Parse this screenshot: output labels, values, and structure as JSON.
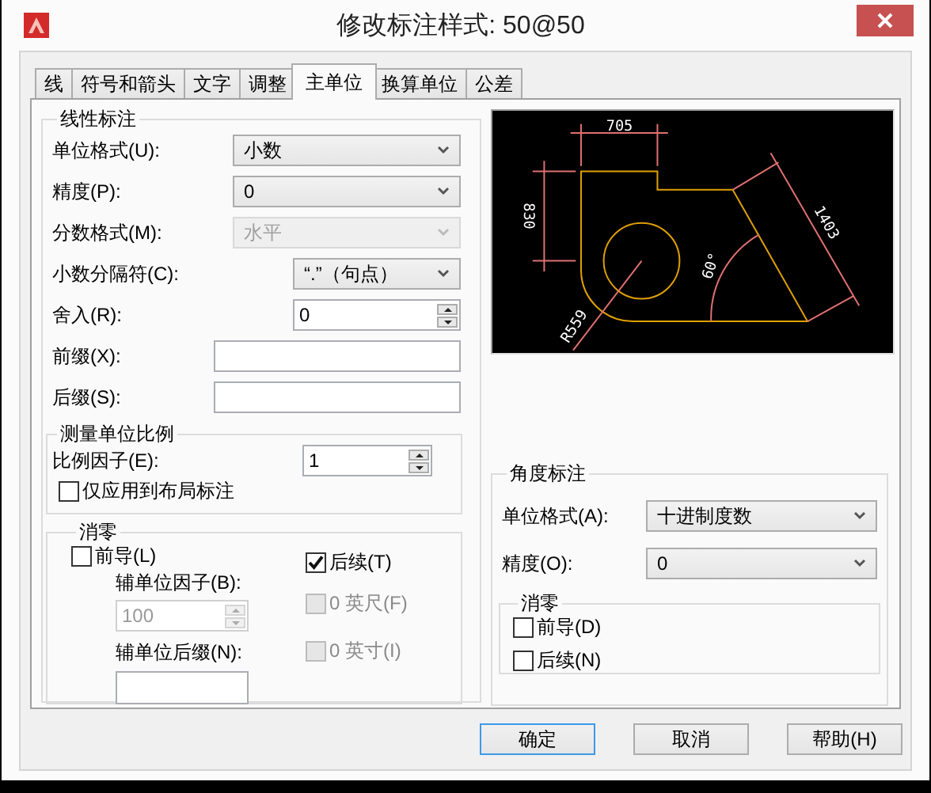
{
  "window": {
    "title": "修改标注样式: 50@50"
  },
  "tabs": [
    {
      "label": "线",
      "selected": false
    },
    {
      "label": "符号和箭头",
      "selected": false
    },
    {
      "label": "文字",
      "selected": false
    },
    {
      "label": "调整",
      "selected": false
    },
    {
      "label": "主单位",
      "selected": true
    },
    {
      "label": "换算单位",
      "selected": false
    },
    {
      "label": "公差",
      "selected": false
    }
  ],
  "linear": {
    "title": "线性标注",
    "fields": [
      {
        "kind": "combo",
        "label": "单位格式(U):",
        "value": "小数",
        "disabled": false
      },
      {
        "kind": "combo",
        "label": "精度(P):",
        "value": "0",
        "disabled": false
      },
      {
        "kind": "combo",
        "label": "分数格式(M):",
        "value": "水平",
        "disabled": true
      },
      {
        "kind": "combo",
        "label": "小数分隔符(C):",
        "value": "“.”（句点）",
        "disabled": false
      },
      {
        "kind": "spinner",
        "label": "舍入(R):",
        "value": "0"
      },
      {
        "kind": "text",
        "label": "前缀(X):"
      },
      {
        "kind": "text",
        "label": "后缀(S):"
      }
    ]
  },
  "scale": {
    "title": "测量单位比例",
    "factor_label": "比例因子(E):",
    "factor": "1",
    "layout_only": {
      "label": "仅应用到布局标注",
      "checked": false
    }
  },
  "zero_suppression": {
    "title": "消零",
    "leading": {
      "label": "前导(L)",
      "checked": false
    },
    "sub_factor_label": "辅单位因子(B):",
    "sub_factor": "100",
    "sub_suffix_label": "辅单位后缀(N):",
    "trailing": {
      "label": "后续(T)",
      "checked": true,
      "disabled": false
    },
    "feet": {
      "label": "0 英尺(F)",
      "checked": false,
      "disabled": true
    },
    "inches": {
      "label": "0 英寸(I)",
      "checked": false,
      "disabled": true
    }
  },
  "preview": {
    "dimension_labels": [
      "705",
      "830",
      "1403",
      "60°",
      "R559"
    ]
  },
  "angular": {
    "title": "角度标注",
    "fields": [
      {
        "kind": "combo",
        "label": "单位格式(A):",
        "value": "十进制度数",
        "disabled": false
      },
      {
        "kind": "combo",
        "label": "精度(O):",
        "value": "0",
        "disabled": false
      }
    ],
    "zero_title": "消零",
    "leading": {
      "label": "前导(D)",
      "checked": false
    },
    "trailing": {
      "label": "后续(N)",
      "checked": false
    }
  },
  "buttons": [
    {
      "label": "确定",
      "default": true
    },
    {
      "label": "取消",
      "default": false
    },
    {
      "label": "帮助(H)",
      "default": false
    }
  ]
}
